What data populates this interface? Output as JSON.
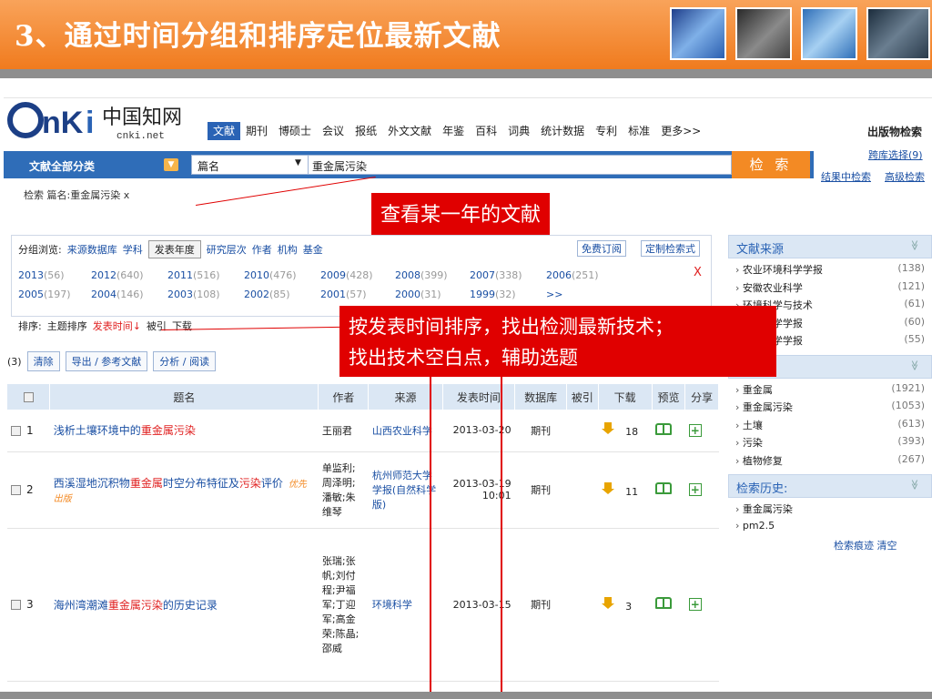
{
  "slide": {
    "title": "3、通过时间分组和排序定位最新文献"
  },
  "logo": {
    "brand": "CNKi中国知网",
    "domain": "cnki.net"
  },
  "top_nav": {
    "items": [
      "文献",
      "期刊",
      "博硕士",
      "会议",
      "报纸",
      "外文文献",
      "年鉴",
      "百科",
      "词典",
      "统计数据",
      "专利",
      "标准",
      "更多>>"
    ],
    "publisher": "出版物检索",
    "db_select": "跨库选择(9)"
  },
  "search": {
    "category": "文献全部分类",
    "field": "篇名",
    "query": "重金属污染",
    "button": "检 索",
    "within": "结果中检索",
    "advanced": "高级检索",
    "crumb": "检索   篇名:重金属污染   x"
  },
  "grouping": {
    "label": "分组浏览:",
    "tabs": [
      "来源数据库",
      "学科",
      "发表年度",
      "研究层次",
      "作者",
      "机构",
      "基金"
    ],
    "selected_tab": "发表年度",
    "subscribe": "免费订阅",
    "custom_expr": "定制检索式",
    "close": "X",
    "years_row1": [
      {
        "year": "2013",
        "count": "(56)"
      },
      {
        "year": "2012",
        "count": "(640)"
      },
      {
        "year": "2011",
        "count": "(516)"
      },
      {
        "year": "2010",
        "count": "(476)"
      },
      {
        "year": "2009",
        "count": "(428)"
      },
      {
        "year": "2008",
        "count": "(399)"
      },
      {
        "year": "2007",
        "count": "(338)"
      },
      {
        "year": "2006",
        "count": "(251)"
      }
    ],
    "years_row2": [
      {
        "year": "2005",
        "count": "(197)"
      },
      {
        "year": "2004",
        "count": "(146)"
      },
      {
        "year": "2003",
        "count": "(108)"
      },
      {
        "year": "2002",
        "count": "(85)"
      },
      {
        "year": "2001",
        "count": "(57)"
      },
      {
        "year": "2000",
        "count": "(31)"
      },
      {
        "year": "1999",
        "count": "(32)"
      },
      {
        "year": ">>",
        "count": ""
      }
    ]
  },
  "sort": {
    "label": "排序:",
    "options": [
      "主题排序",
      "发表时间↓",
      "被引",
      "下载"
    ],
    "active": "发表时间↓"
  },
  "toolbar": {
    "count": "(3)",
    "clear": "清除",
    "export": "导出 / 参考文献",
    "analyze": "分析 / 阅读"
  },
  "table": {
    "headers": [
      "",
      "题名",
      "作者",
      "来源",
      "发表时间",
      "数据库",
      "被引",
      "下载",
      "预览",
      "分享"
    ],
    "rows": [
      {
        "n": "1",
        "title_pre": "浅析土壤环境中的",
        "title_hl": "重金属污染",
        "title_post": "",
        "title_hl2": "",
        "title_post2": "",
        "badge": "",
        "authors": "王丽君",
        "source": "山西农业科学",
        "date": "2013-03-20",
        "db": "期刊",
        "cited": "",
        "downloads": "18"
      },
      {
        "n": "2",
        "title_pre": "西溪湿地沉积物",
        "title_hl": "重金属",
        "title_post": "时空分布特征及",
        "title_hl2": "污染",
        "title_post2": "评价",
        "badge": "优先出版",
        "authors": "单监利;周泽明;潘敏;朱维琴",
        "source": "杭州师范大学学报(自然科学版)",
        "date": "2013-03-19 10:01",
        "db": "期刊",
        "cited": "",
        "downloads": "11"
      },
      {
        "n": "3",
        "title_pre": "海州湾潮滩",
        "title_hl": "重金属污染",
        "title_post": "的历史记录",
        "title_hl2": "",
        "title_post2": "",
        "badge": "",
        "authors": "张瑞;张帆;刘付程;尹福军;丁迎军;高金荣;陈晶;邵威",
        "source": "环境科学",
        "date": "2013-03-15",
        "db": "期刊",
        "cited": "",
        "downloads": "3"
      }
    ]
  },
  "sidebar": {
    "sources": {
      "title": "文献来源",
      "items": [
        {
          "name": "农业环境科学学报",
          "count": "(138)"
        },
        {
          "name": "安徽农业科学",
          "count": "(121)"
        },
        {
          "name": "环境科学与技术",
          "count": "(61)"
        },
        {
          "name": "环境科学学报",
          "count": "(60)"
        },
        {
          "name": "环境科学学报",
          "count": "(55)"
        }
      ]
    },
    "keywords": {
      "title": "关键词",
      "items": [
        {
          "name": "重金属",
          "count": "(1921)"
        },
        {
          "name": "重金属污染",
          "count": "(1053)"
        },
        {
          "name": "土壤",
          "count": "(613)"
        },
        {
          "name": "污染",
          "count": "(393)"
        },
        {
          "name": "植物修复",
          "count": "(267)"
        }
      ]
    },
    "history": {
      "title": "检索历史:",
      "items": [
        "重金属污染",
        "pm2.5"
      ],
      "trace": "检索痕迹",
      "clear": "清空"
    }
  },
  "callouts": {
    "year": "查看某一年的文献",
    "sort_line1": "按发表时间排序，找出检测最新技术；",
    "sort_line2": "找出技术空白点，辅助选题"
  }
}
